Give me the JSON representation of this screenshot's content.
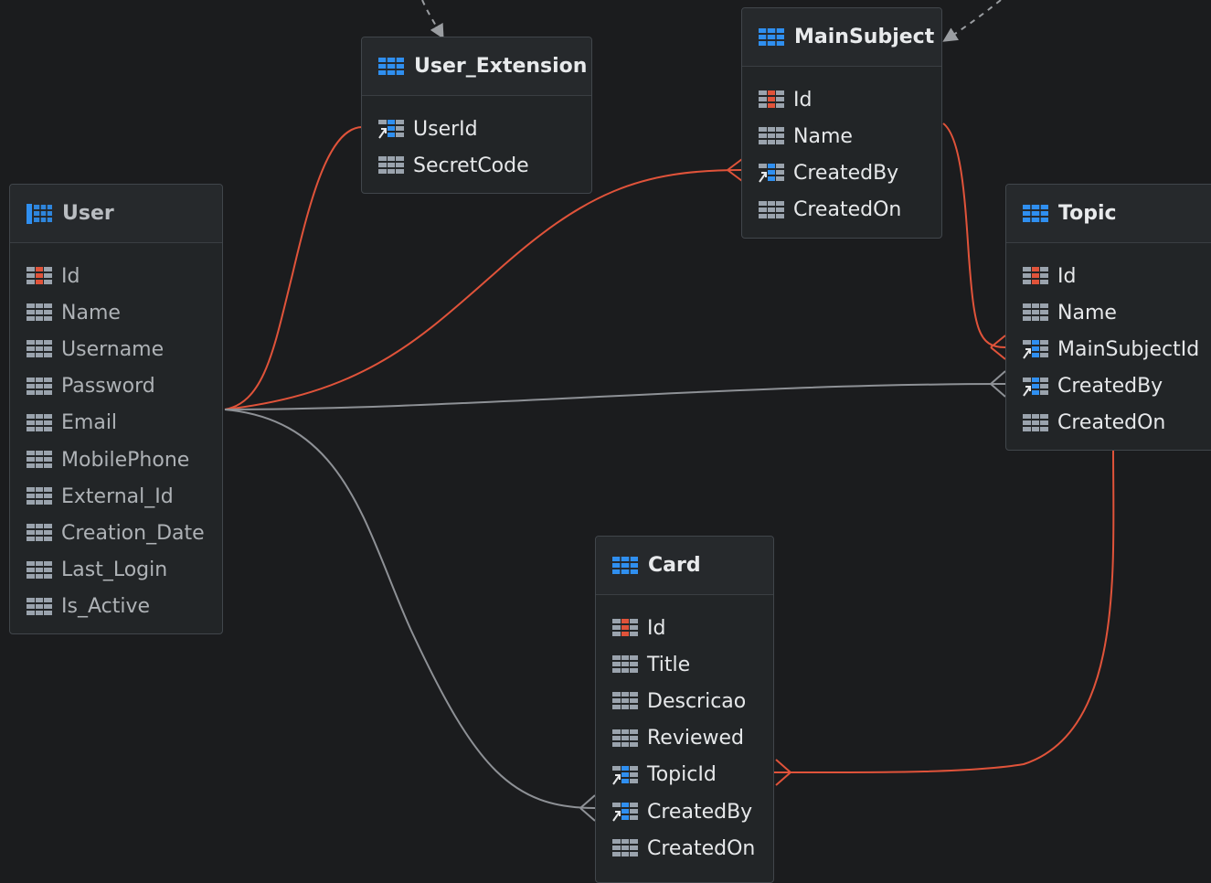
{
  "entities": {
    "user": {
      "name": "User",
      "fields": [
        "Id",
        "Name",
        "Username",
        "Password",
        "Email",
        "MobilePhone",
        "External_Id",
        "Creation_Date",
        "Last_Login",
        "Is_Active"
      ]
    },
    "user_extension": {
      "name": "User_Extension",
      "fields": [
        "UserId",
        "SecretCode"
      ]
    },
    "mainsubject": {
      "name": "MainSubject",
      "fields": [
        "Id",
        "Name",
        "CreatedBy",
        "CreatedOn"
      ]
    },
    "topic": {
      "name": "Topic",
      "fields": [
        "Id",
        "Name",
        "MainSubjectId",
        "CreatedBy",
        "CreatedOn"
      ]
    },
    "card": {
      "name": "Card",
      "fields": [
        "Id",
        "Title",
        "Descricao",
        "Reviewed",
        "TopicId",
        "CreatedBy",
        "CreatedOn"
      ]
    }
  },
  "icons": {
    "table": "table-icon",
    "primary_key": "primary-key-column-icon",
    "foreign_key": "foreign-key-column-icon",
    "column": "column-icon"
  },
  "colors": {
    "background": "#1b1c1e",
    "relation_highlight": "#e0533a",
    "relation_default": "#8e9196",
    "table_icon": "#2f8ff0",
    "primary_key_icon": "#e0533a"
  }
}
